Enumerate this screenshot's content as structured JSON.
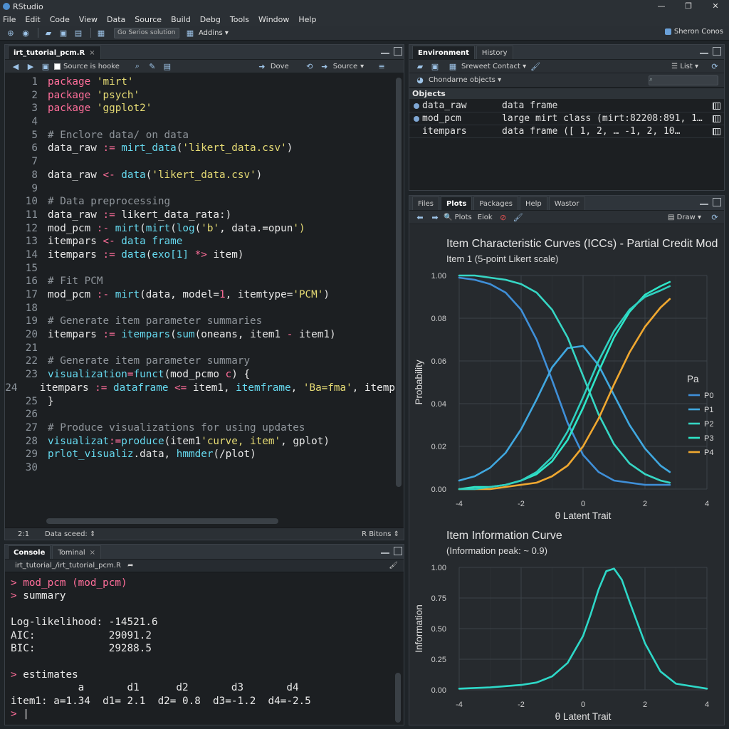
{
  "app": {
    "title": "RStudio"
  },
  "menu": [
    "File",
    "Edit",
    "Code",
    "View",
    "Data",
    "Source",
    "Build",
    "Debg",
    "Tools",
    "Window",
    "Help"
  ],
  "toolbar": {
    "goto_placeholder": "Go Serios solution",
    "addins_label": "Addins",
    "project_label": "Sheron Conos"
  },
  "editor": {
    "tab_label": "irt_tutorial_pcm.R",
    "source_on_save": "Source is hooke",
    "run_label": "Dove",
    "source_label": "Source",
    "status": {
      "position": "2:1",
      "scope": "Data sceed:",
      "filetype": "R Bitons"
    },
    "lines": [
      [
        {
          "t": "package ",
          "c": "kw"
        },
        {
          "t": "'mirt'",
          "c": "str"
        }
      ],
      [
        {
          "t": "package ",
          "c": "kw"
        },
        {
          "t": "'psych'",
          "c": "str"
        }
      ],
      [
        {
          "t": "package ",
          "c": "kw"
        },
        {
          "t": "'ggplot2'",
          "c": "str"
        }
      ],
      [],
      [
        {
          "t": "# Enclore data/ on data",
          "c": "com"
        }
      ],
      [
        {
          "t": "data_raw ",
          "c": "id"
        },
        {
          "t": ":= ",
          "c": "op"
        },
        {
          "t": "mirt_data",
          "c": "fn"
        },
        {
          "t": "(",
          "c": "id"
        },
        {
          "t": "'likert_data.csv'",
          "c": "str"
        },
        {
          "t": ")",
          "c": "id"
        }
      ],
      [],
      [
        {
          "t": "data_raw ",
          "c": "id"
        },
        {
          "t": "<- ",
          "c": "op"
        },
        {
          "t": "data",
          "c": "fn"
        },
        {
          "t": "(",
          "c": "id"
        },
        {
          "t": "'likert_data.csv'",
          "c": "str"
        },
        {
          "t": ")",
          "c": "id"
        }
      ],
      [],
      [
        {
          "t": "# Data preprocessing",
          "c": "com"
        }
      ],
      [
        {
          "t": "data_raw ",
          "c": "id"
        },
        {
          "t": ":= ",
          "c": "op"
        },
        {
          "t": "likert_data_rata:)",
          "c": "id"
        }
      ],
      [
        {
          "t": "mod_pcm ",
          "c": "id"
        },
        {
          "t": ":- ",
          "c": "op"
        },
        {
          "t": "mirt",
          "c": "fn"
        },
        {
          "t": "(",
          "c": "id"
        },
        {
          "t": "mirt",
          "c": "fn"
        },
        {
          "t": "(",
          "c": "id"
        },
        {
          "t": "log",
          "c": "fn"
        },
        {
          "t": "(",
          "c": "id"
        },
        {
          "t": "'b'",
          "c": "str"
        },
        {
          "t": ", data.=opun",
          "c": "id"
        },
        {
          "t": "')",
          "c": "str"
        }
      ],
      [
        {
          "t": "itempars ",
          "c": "id"
        },
        {
          "t": "<- ",
          "c": "op"
        },
        {
          "t": "data frame",
          "c": "fn"
        }
      ],
      [
        {
          "t": "itempars ",
          "c": "id"
        },
        {
          "t": ":= ",
          "c": "op"
        },
        {
          "t": "data",
          "c": "fn"
        },
        {
          "t": "(",
          "c": "id"
        },
        {
          "t": "exo[1] ",
          "c": "fn"
        },
        {
          "t": "*> ",
          "c": "op"
        },
        {
          "t": "item)",
          "c": "id"
        }
      ],
      [],
      [
        {
          "t": "# Fit PCM",
          "c": "com"
        }
      ],
      [
        {
          "t": "mod_pcm ",
          "c": "id"
        },
        {
          "t": ":- ",
          "c": "op"
        },
        {
          "t": "mirt",
          "c": "fn"
        },
        {
          "t": "(data, model=",
          "c": "id"
        },
        {
          "t": "1",
          "c": "kw"
        },
        {
          "t": ", itemtype=",
          "c": "id"
        },
        {
          "t": "'PCM'",
          "c": "str"
        },
        {
          "t": ")",
          "c": "id"
        }
      ],
      [],
      [
        {
          "t": "# Generate item parameter summaries",
          "c": "com"
        }
      ],
      [
        {
          "t": "itempars ",
          "c": "id"
        },
        {
          "t": ":= ",
          "c": "op"
        },
        {
          "t": "itempars",
          "c": "fn"
        },
        {
          "t": "(",
          "c": "id"
        },
        {
          "t": "sum",
          "c": "fn"
        },
        {
          "t": "(oneans, item1 ",
          "c": "id"
        },
        {
          "t": "- ",
          "c": "op"
        },
        {
          "t": "item1)",
          "c": "id"
        }
      ],
      [],
      [
        {
          "t": "# Generate item parameter summary",
          "c": "com"
        }
      ],
      [
        {
          "t": "visualization",
          "c": "fn"
        },
        {
          "t": "=",
          "c": "op"
        },
        {
          "t": "funct",
          "c": "fn"
        },
        {
          "t": "(mod_pcmo ",
          "c": "id"
        },
        {
          "t": "c",
          "c": "op"
        },
        {
          "t": ") {",
          "c": "id"
        }
      ],
      [
        {
          "t": "  itempars ",
          "c": "id"
        },
        {
          "t": ":= ",
          "c": "op"
        },
        {
          "t": "dataframe ",
          "c": "fn"
        },
        {
          "t": "<= ",
          "c": "op"
        },
        {
          "t": "item1, ",
          "c": "id"
        },
        {
          "t": "itemframe",
          "c": "fn"
        },
        {
          "t": ", ",
          "c": "id"
        },
        {
          "t": "'Ba=fma'",
          "c": "str"
        },
        {
          "t": ", itemp",
          "c": "id"
        }
      ],
      [
        {
          "t": "}",
          "c": "id"
        }
      ],
      [],
      [
        {
          "t": "# Produce visualizations for using updates",
          "c": "com"
        }
      ],
      [
        {
          "t": "visualizat",
          "c": "fn"
        },
        {
          "t": ":=",
          "c": "op"
        },
        {
          "t": "produce",
          "c": "fn"
        },
        {
          "t": "(item1",
          "c": "id"
        },
        {
          "t": "'curve, item'",
          "c": "str"
        },
        {
          "t": ", gplot)",
          "c": "id"
        }
      ],
      [
        {
          "t": "prlot_visualiz",
          "c": "fn"
        },
        {
          "t": ".data, ",
          "c": "id"
        },
        {
          "t": "hmmder",
          "c": "fn"
        },
        {
          "t": "(/plot)",
          "c": "id"
        }
      ],
      []
    ]
  },
  "console": {
    "tabs": [
      "Console",
      "Tominal"
    ],
    "path": "irt_tutorial_/irt_tutorial_pcm.R",
    "lines": [
      {
        "p": "> ",
        "t": "mod_pcm (mod_pcm)",
        "c": "kw"
      },
      {
        "p": "> ",
        "t": "summary",
        "c": "id"
      },
      {
        "p": "",
        "t": "",
        "c": "id"
      },
      {
        "p": "",
        "t": "Log-likelihood: -14521.6",
        "c": "id"
      },
      {
        "p": "",
        "t": "AIC:            29091.2",
        "c": "id"
      },
      {
        "p": "",
        "t": "BIC:            29288.5",
        "c": "id"
      },
      {
        "p": "",
        "t": "",
        "c": "id"
      },
      {
        "p": "> ",
        "t": "estimates",
        "c": "id"
      },
      {
        "p": "",
        "t": "           a       d1      d2       d3       d4",
        "c": "id"
      },
      {
        "p": "",
        "t": "item1: a=1.34  d1= 2.1  d2= 0.8  d3=-1.2  d4=-2.5",
        "c": "id"
      },
      {
        "p": "> ",
        "t": "|",
        "c": "id"
      }
    ]
  },
  "environment": {
    "tabs": [
      "Environment",
      "History"
    ],
    "import_label": "Sreweet Contact",
    "list_label": "List",
    "scope_label": "Chondarne objects",
    "section": "Objects",
    "objects": [
      {
        "name": "data_raw",
        "value": "data frame"
      },
      {
        "name": "mod_pcm",
        "value": "large mirt class (mirt:82208:891, 1…"
      },
      {
        "name": "itempars",
        "value": "data frame ([ 1, 2, … -1, 2, 10…"
      }
    ]
  },
  "plots": {
    "tabs": [
      "Files",
      "Plots",
      "Packages",
      "Help",
      "Wastor"
    ],
    "plots_label": "Plots",
    "export_label": "Eiok",
    "draw_label": "Draw"
  },
  "chart_data": [
    {
      "type": "line",
      "title": "Item Characteristic Curves (ICCs) - Partial Credit Mod",
      "subtitle": "Item 1 (5-point Likert scale)",
      "xlabel": "θ Latent Trait",
      "ylabel": "Probability",
      "xlim": [
        -4,
        4
      ],
      "ylim": [
        0,
        1
      ],
      "xticks": [
        "-4",
        "-2",
        "0",
        "2",
        "4"
      ],
      "yticks": [
        "0.00",
        "0.02",
        "0.04",
        "0.06",
        "0.08",
        "1.00"
      ],
      "legend_title": "Pa",
      "legend_position": "right",
      "x": [
        -4,
        -3.5,
        -3,
        -2.5,
        -2,
        -1.5,
        -1,
        -0.5,
        0,
        0.5,
        1,
        1.5,
        2,
        2.5,
        2.8
      ],
      "series": [
        {
          "name": "P0",
          "color": "#3f8fd8",
          "values": [
            0.99,
            0.98,
            0.96,
            0.92,
            0.84,
            0.7,
            0.51,
            0.31,
            0.16,
            0.08,
            0.04,
            0.03,
            0.02,
            0.02,
            0.02
          ]
        },
        {
          "name": "P1",
          "color": "#40a8e0",
          "values": [
            0.04,
            0.06,
            0.1,
            0.17,
            0.28,
            0.42,
            0.57,
            0.66,
            0.67,
            0.58,
            0.44,
            0.3,
            0.19,
            0.11,
            0.08
          ]
        },
        {
          "name": "P2",
          "color": "#36d6c4",
          "values": [
            1.0,
            1.0,
            0.99,
            0.98,
            0.96,
            0.92,
            0.84,
            0.71,
            0.53,
            0.35,
            0.21,
            0.12,
            0.07,
            0.04,
            0.03
          ]
        },
        {
          "name": "P3",
          "color": "#2ee6c8",
          "values": [
            0.0,
            0.01,
            0.01,
            0.02,
            0.04,
            0.07,
            0.13,
            0.23,
            0.38,
            0.55,
            0.71,
            0.83,
            0.91,
            0.95,
            0.97
          ]
        },
        {
          "name": "P4",
          "color": "#f0a830",
          "values": [
            0.0,
            0.0,
            0.0,
            0.01,
            0.02,
            0.03,
            0.06,
            0.11,
            0.2,
            0.33,
            0.49,
            0.64,
            0.76,
            0.85,
            0.89
          ]
        },
        {
          "name": "",
          "color": "#2fd0c0",
          "values": [
            0.0,
            0.0,
            0.01,
            0.02,
            0.04,
            0.08,
            0.15,
            0.27,
            0.43,
            0.6,
            0.74,
            0.84,
            0.9,
            0.93,
            0.95
          ]
        }
      ]
    },
    {
      "type": "line",
      "title": "Item Information Curve",
      "subtitle": "(Information peak: ~ 0.9)",
      "xlabel": "θ Latent Trait",
      "ylabel": "Information",
      "xlim": [
        -4,
        4
      ],
      "ylim": [
        0,
        1
      ],
      "xticks": [
        "-4",
        "-2",
        "0",
        "2",
        "4"
      ],
      "yticks": [
        "0.00",
        "0.25",
        "0.50",
        "0.75",
        "1.00"
      ],
      "x": [
        -4,
        -3,
        -2,
        -1.5,
        -1,
        -0.5,
        0,
        0.25,
        0.5,
        0.75,
        1,
        1.25,
        1.5,
        2,
        2.5,
        3,
        4
      ],
      "series": [
        {
          "name": "",
          "color": "#2ed8c8",
          "values": [
            0.01,
            0.02,
            0.04,
            0.06,
            0.11,
            0.22,
            0.44,
            0.62,
            0.82,
            0.97,
            0.99,
            0.9,
            0.72,
            0.38,
            0.15,
            0.05,
            0.01
          ]
        }
      ]
    }
  ]
}
